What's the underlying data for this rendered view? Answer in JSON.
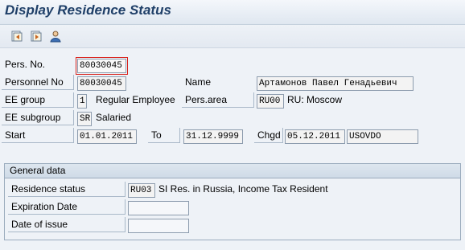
{
  "header": {
    "title": "Display Residence Status"
  },
  "toolbar": {
    "icons": [
      "previous-record-icon",
      "next-record-icon",
      "person-icon"
    ]
  },
  "form": {
    "pers_no": {
      "label": "Pers. No.",
      "value": "80030045"
    },
    "personnel_no": {
      "label": "Personnel No",
      "value": "80030045"
    },
    "name": {
      "label": "Name",
      "value": "Артамонов Павел Генадьевич"
    },
    "ee_group": {
      "label": "EE group",
      "value": "1",
      "text": "Regular Employee"
    },
    "pers_area": {
      "label": "Pers.area",
      "value": "RU00",
      "text": "RU: Moscow"
    },
    "ee_subgroup": {
      "label": "EE subgroup",
      "value": "SR",
      "text": "Salaried"
    },
    "start": {
      "label": "Start",
      "value": "01.01.2011"
    },
    "to": {
      "label": "To",
      "value": "31.12.9999"
    },
    "chgd": {
      "label": "Chgd",
      "date": "05.12.2011",
      "user": "USOVDO"
    }
  },
  "general_data": {
    "title": "General data",
    "residence_status": {
      "label": "Residence status",
      "value": "RU03",
      "text": "SI Res. in Russia, Income Tax Resident"
    },
    "expiration_date": {
      "label": "Expiration Date",
      "value": ""
    },
    "date_of_issue": {
      "label": "Date of issue",
      "value": ""
    }
  }
}
